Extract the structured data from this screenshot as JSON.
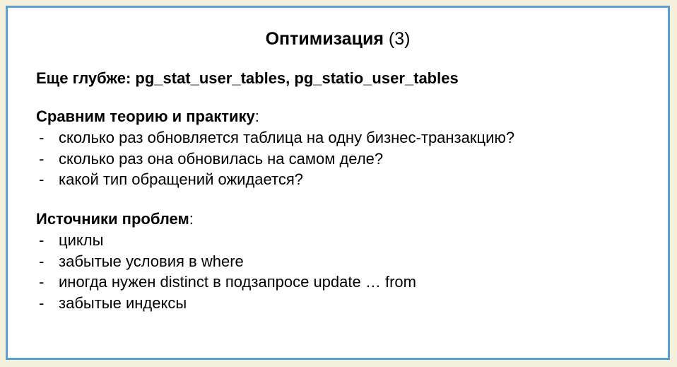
{
  "title": {
    "bold": "Оптимизация",
    "rest": " (3)"
  },
  "subhead": "Еще глубже: pg_stat_user_tables,  pg_statio_user_tables",
  "section1": {
    "title_bold": "Сравним теорию и практику",
    "title_rest": ":",
    "items": [
      "сколько раз обновляется таблица на одну бизнес-транзакцию?",
      "сколько раз она обновилась на самом деле?",
      "какой тип обращений ожидается?"
    ]
  },
  "section2": {
    "title_bold": "Источники проблем",
    "title_rest": ":",
    "items": [
      "циклы",
      "забытые условия в where",
      "иногда нужен distinct в подзапросе update … from",
      "забытые индексы"
    ]
  }
}
